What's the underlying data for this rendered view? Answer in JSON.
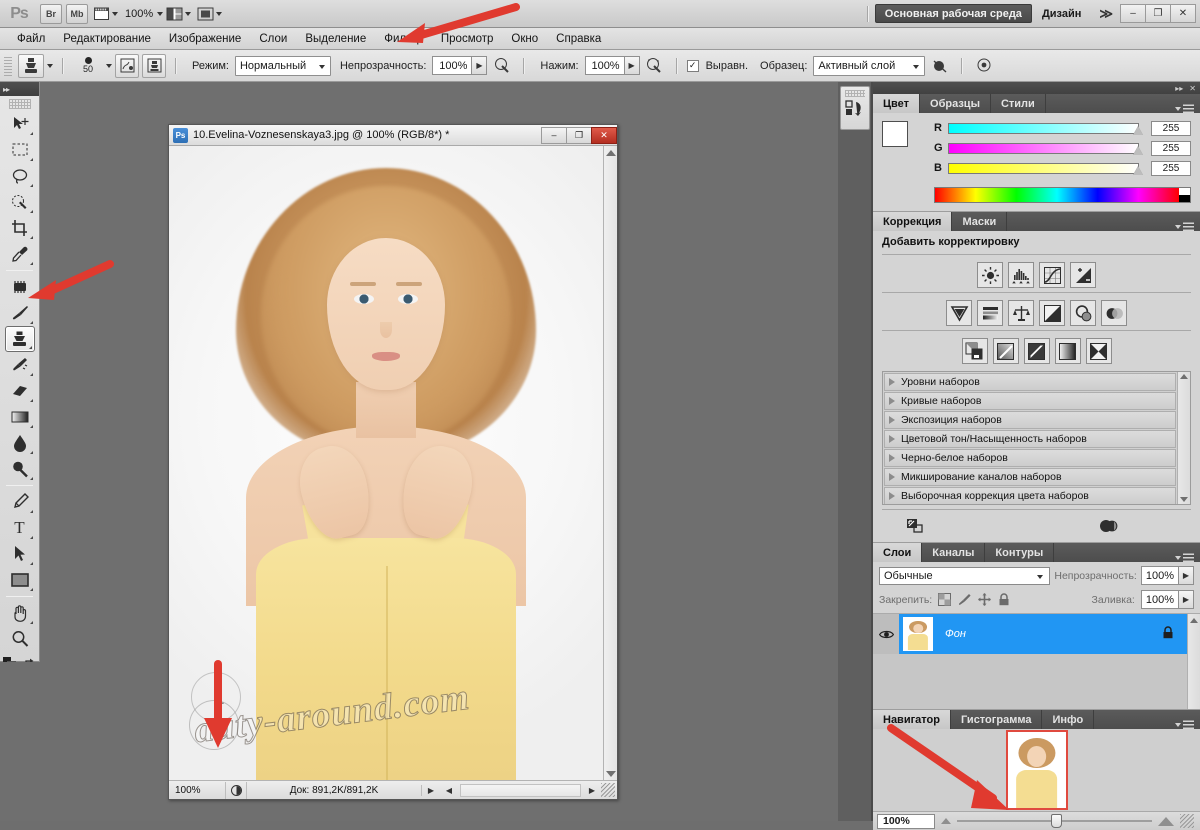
{
  "app": {
    "logo": "Ps",
    "title_buttons": [
      {
        "name": "bridge",
        "label": "Br"
      },
      {
        "name": "mini-bridge",
        "label": "Mb"
      }
    ],
    "view_extras_label": "",
    "zoom_level": "100%",
    "workspace_button": "Основная рабочая среда",
    "workspace_secondary": "Дизайн",
    "workspace_more": "≫",
    "window_controls": [
      "–",
      "❐",
      "✕"
    ]
  },
  "menubar": {
    "items": [
      {
        "label": "Файл",
        "name": "menu-file"
      },
      {
        "label": "Редактирование",
        "name": "menu-edit"
      },
      {
        "label": "Изображение",
        "name": "menu-image"
      },
      {
        "label": "Слои",
        "name": "menu-layers"
      },
      {
        "label": "Выделение",
        "name": "menu-select"
      },
      {
        "label": "Фильтр",
        "name": "menu-filter"
      },
      {
        "label": "Просмотр",
        "name": "menu-view"
      },
      {
        "label": "Окно",
        "name": "menu-window"
      },
      {
        "label": "Справка",
        "name": "menu-help"
      }
    ]
  },
  "options_bar": {
    "tool": "clone-stamp",
    "brush_size": "50",
    "mode_label": "Режим:",
    "mode_value": "Нормальный",
    "opacity_label": "Непрозрачность:",
    "opacity_value": "100%",
    "flow_label": "Нажим:",
    "flow_value": "100%",
    "aligned_label": "Выравн.",
    "aligned_checked": "✓",
    "sample_label": "Образец:",
    "sample_value": "Активный слой"
  },
  "toolbox": {
    "tools": [
      {
        "name": "move-tool",
        "glyph": "move"
      },
      {
        "name": "marquee-tool",
        "glyph": "marquee"
      },
      {
        "name": "lasso-tool",
        "glyph": "lasso"
      },
      {
        "name": "quick-select-tool",
        "glyph": "quickselect"
      },
      {
        "name": "crop-tool",
        "glyph": "crop"
      },
      {
        "name": "eyedropper-tool",
        "glyph": "eyedropper"
      },
      {
        "name": "spot-healing-tool",
        "glyph": "healing"
      },
      {
        "name": "brush-tool",
        "glyph": "brush"
      },
      {
        "name": "clone-stamp-tool",
        "glyph": "stamp",
        "selected": true
      },
      {
        "name": "history-brush-tool",
        "glyph": "historybrush"
      },
      {
        "name": "eraser-tool",
        "glyph": "eraser"
      },
      {
        "name": "gradient-tool",
        "glyph": "gradient"
      },
      {
        "name": "blur-tool",
        "glyph": "blur"
      },
      {
        "name": "dodge-tool",
        "glyph": "dodge"
      },
      {
        "name": "pen-tool",
        "glyph": "pen"
      },
      {
        "name": "type-tool",
        "glyph": "T"
      },
      {
        "name": "path-selection-tool",
        "glyph": "pathselect"
      },
      {
        "name": "shape-tool",
        "glyph": "rectangle"
      },
      {
        "name": "hand-tool",
        "glyph": "hand"
      },
      {
        "name": "zoom-tool",
        "glyph": "zoom"
      }
    ],
    "quick_mask_name": "quick-mask-button"
  },
  "document": {
    "title": "10.Evelina-Voznesenskaya3.jpg @ 100% (RGB/8*) *",
    "icon": "Ps",
    "window_buttons": [
      "–",
      "❐",
      "✕"
    ],
    "zoom": "100%",
    "doc_info": "Док: 891,2K/891,2K",
    "watermark": "auty-around.com"
  },
  "panels": {
    "color": {
      "tabs": [
        "Цвет",
        "Образцы",
        "Стили"
      ],
      "active_tab": "Цвет",
      "channels": [
        {
          "label": "R",
          "value": "255"
        },
        {
          "label": "G",
          "value": "255"
        },
        {
          "label": "B",
          "value": "255"
        }
      ]
    },
    "adjustments": {
      "tabs": [
        "Коррекция",
        "Маски"
      ],
      "active_tab": "Коррекция",
      "heading": "Добавить корректировку",
      "icon_rows": [
        [
          {
            "name": "brightness-contrast-icon"
          },
          {
            "name": "levels-icon"
          },
          {
            "name": "curves-icon"
          },
          {
            "name": "exposure-icon"
          }
        ],
        [
          {
            "name": "vibrance-icon"
          },
          {
            "name": "hue-saturation-icon"
          },
          {
            "name": "color-balance-icon"
          },
          {
            "name": "black-white-icon"
          },
          {
            "name": "photo-filter-icon"
          },
          {
            "name": "channel-mixer-icon"
          }
        ],
        [
          {
            "name": "invert-icon"
          },
          {
            "name": "posterize-icon"
          },
          {
            "name": "threshold-icon"
          },
          {
            "name": "gradient-map-icon"
          },
          {
            "name": "selective-color-icon"
          }
        ]
      ],
      "presets": [
        "Уровни наборов",
        "Кривые наборов",
        "Экспозиция наборов",
        "Цветовой тон/Насыщенность наборов",
        "Черно-белое наборов",
        "Микширование каналов наборов",
        "Выборочная коррекция цвета наборов"
      ]
    },
    "layers": {
      "tabs": [
        "Слои",
        "Каналы",
        "Контуры"
      ],
      "active_tab": "Слои",
      "blend_mode": "Обычные",
      "opacity_label": "Непрозрачность:",
      "opacity_value": "100%",
      "lock_label": "Закрепить:",
      "fill_label": "Заливка:",
      "fill_value": "100%",
      "items": [
        {
          "name": "Фон",
          "locked": true,
          "visible": true
        }
      ]
    },
    "navigator": {
      "tabs": [
        "Навигатор",
        "Гистограмма",
        "Инфо"
      ],
      "active_tab": "Навигатор",
      "zoom_value": "100%"
    }
  },
  "annotations": {
    "arrow_view_menu": "points-to-view-menu",
    "arrow_clone_tool": "points-to-clone-stamp-tool",
    "arrow_canvas_cursor": "points-to-clone-cursor",
    "arrow_navigator_slider": "points-to-zoom-slider",
    "color": "#e03a2f"
  }
}
